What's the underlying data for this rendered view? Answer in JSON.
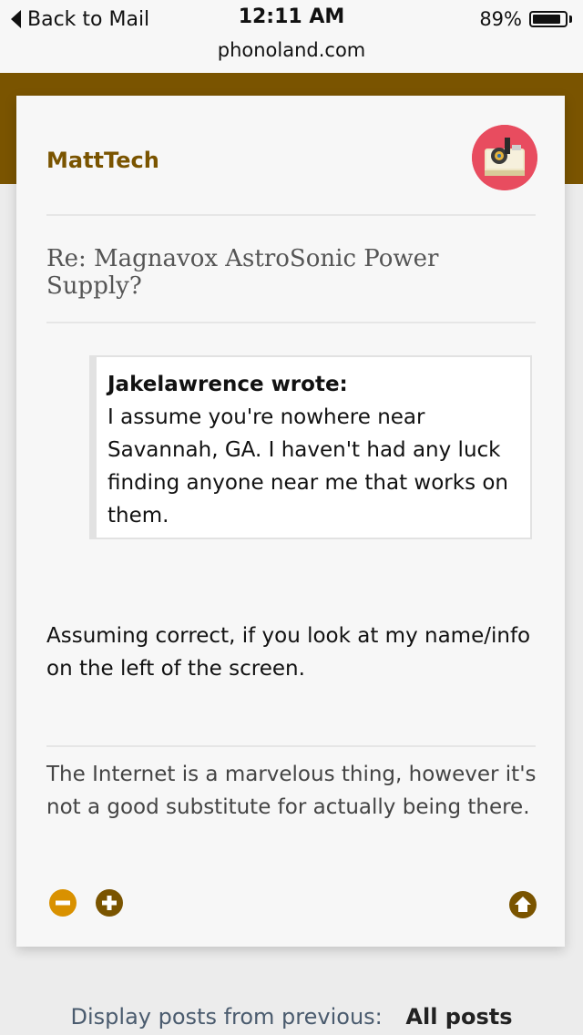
{
  "status_bar": {
    "back_label": "Back to Mail",
    "time": "12:11 AM",
    "battery_percent": "89%",
    "battery_level": 0.89
  },
  "browser": {
    "url": "phonoland.com"
  },
  "post": {
    "author": "MattTech",
    "title": "Re: Magnavox AstroSonic Power Supply?",
    "quote": {
      "author": "Jakelawrence wrote:",
      "text": "I assume you're nowhere near Savannah, GA. I haven't had any luck finding anyone near me that works on them."
    },
    "body": "Assuming correct, if you look at my name/info on the left of the screen.",
    "signature": "The Internet is a marvelous thing, however it's not a good substitute for actually being there.",
    "icons": {
      "minus": "minus-circle-icon",
      "plus": "plus-circle-icon",
      "up": "arrow-up-circle-icon"
    }
  },
  "footer": {
    "display_label": "Display posts from previous:",
    "display_value": "All posts"
  },
  "colors": {
    "brand_brown": "#7a5400",
    "minus_orange": "#d99100",
    "avatar_bg": "#e84c5f"
  }
}
